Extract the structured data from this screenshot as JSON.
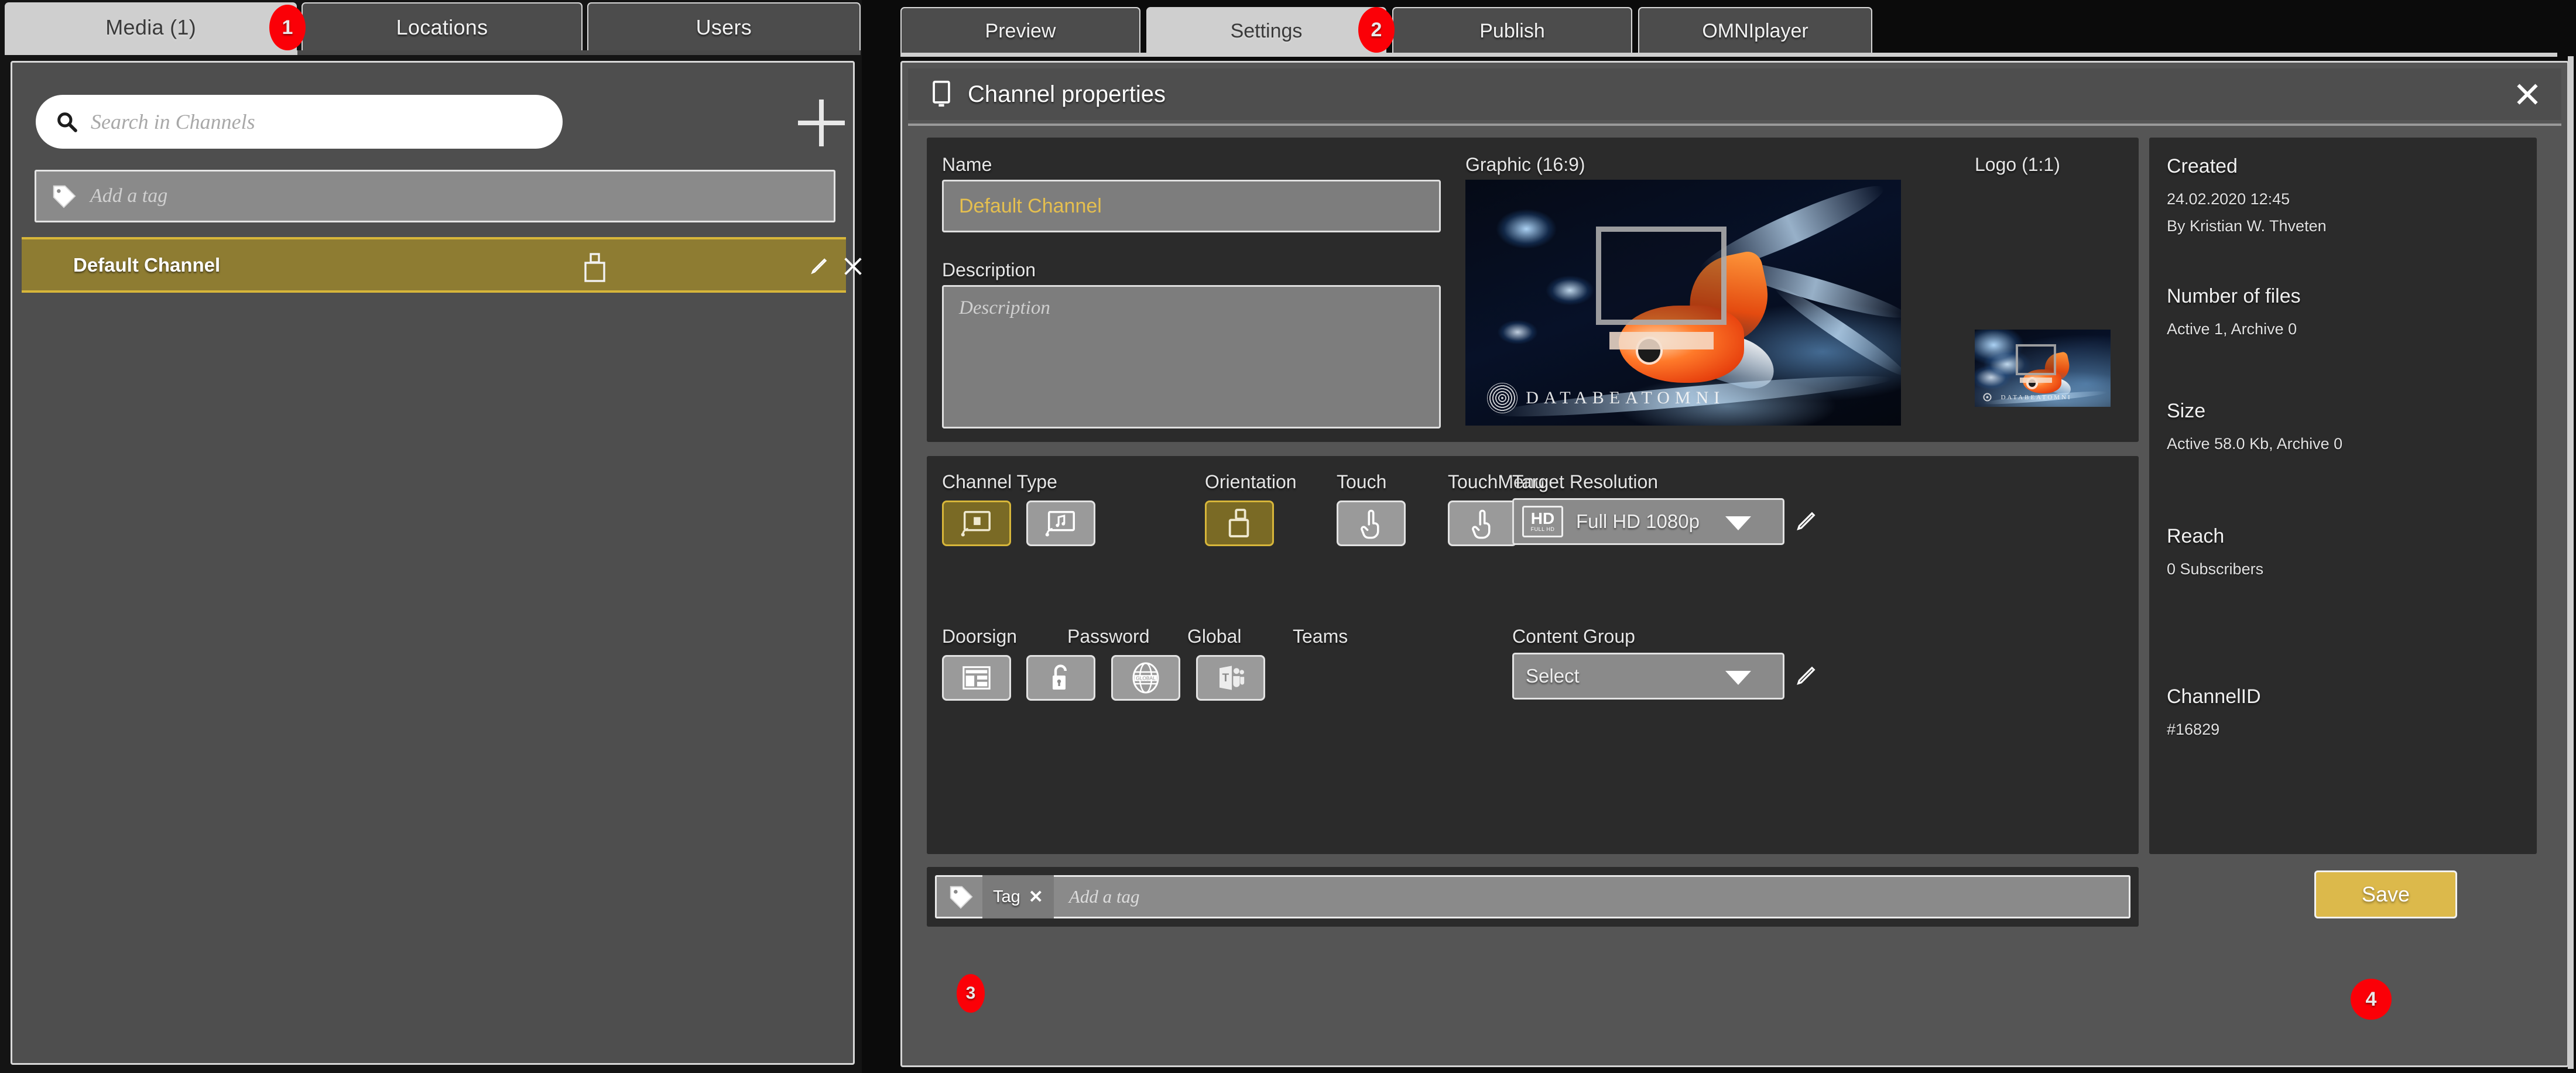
{
  "left": {
    "tabs": [
      {
        "label": "Media (1)",
        "active": true
      },
      {
        "label": "Locations",
        "active": false
      },
      {
        "label": "Users",
        "active": false
      }
    ],
    "search": {
      "placeholder": "Search in Channels",
      "value": "",
      "icon": "search-icon"
    },
    "add_button_icon": "plus-icon",
    "tag_filter": {
      "placeholder": "Add a tag",
      "value": "",
      "icon": "tag-icon"
    },
    "channels": [
      {
        "name": "Default Channel",
        "orientation_icon": "portrait-icon",
        "edit_icon": "pencil-icon",
        "close_icon": "close-icon",
        "selected": true
      }
    ]
  },
  "right": {
    "tabs": [
      {
        "label": "Preview",
        "active": false
      },
      {
        "label": "Settings",
        "active": true
      },
      {
        "label": "Publish",
        "active": false
      },
      {
        "label": "OMNIplayer",
        "active": false
      }
    ],
    "dialog": {
      "title": "Channel properties",
      "title_icon": "monitor-icon",
      "close_icon": "close-icon",
      "name": {
        "label": "Name",
        "value": "Default Channel"
      },
      "description": {
        "label": "Description",
        "value": "",
        "placeholder": "Description"
      },
      "graphic": {
        "label": "Graphic (16:9)",
        "watermark": "DATABEATOMNI"
      },
      "logo": {
        "label": "Logo (1:1)",
        "watermark": "DATABEATOMNI"
      },
      "channel_type": {
        "label": "Channel Type",
        "options": [
          {
            "icon": "screen-signage-icon",
            "selected": true
          },
          {
            "icon": "screen-audio-icon",
            "selected": false
          }
        ]
      },
      "orientation": {
        "label": "Orientation",
        "icon": "orientation-portrait-icon",
        "selected": true
      },
      "touch": {
        "label": "Touch",
        "icon": "touch-hand-icon",
        "selected": false
      },
      "touch_menu": {
        "label": "TouchMenu",
        "icon": "touch-hand-icon",
        "selected": false
      },
      "target_resolution": {
        "label": "Target Resolution",
        "value": "Full HD 1080p",
        "badge": "HD",
        "badge_sub": "FULL HD",
        "caret_icon": "chevron-down-icon",
        "edit_icon": "pencil-icon"
      },
      "doorsign": {
        "label": "Doorsign",
        "icon": "doorsign-icon",
        "selected": false
      },
      "password": {
        "label": "Password",
        "icon": "unlock-icon",
        "selected": false
      },
      "global": {
        "label": "Global",
        "icon": "globe-icon",
        "icon_text": "GLOBAL",
        "selected": false
      },
      "teams": {
        "label": "Teams",
        "icon": "teams-icon",
        "selected": false
      },
      "content_group": {
        "label": "Content Group",
        "value": "Select",
        "caret_icon": "chevron-down-icon",
        "edit_icon": "pencil-icon"
      },
      "tag_row": {
        "icon": "tag-icon",
        "chips": [
          {
            "label": "Tag",
            "remove_icon": "close-icon"
          }
        ],
        "placeholder": "Add a tag"
      },
      "save_label": "Save"
    },
    "info": {
      "created": {
        "label": "Created",
        "date": "24.02.2020 12:45",
        "by": "By Kristian W. Thveten"
      },
      "number_of_files": {
        "label": "Number of files",
        "value": "Active 1, Archive 0"
      },
      "size": {
        "label": "Size",
        "value": "Active 58.0 Kb, Archive 0"
      },
      "reach": {
        "label": "Reach",
        "value": "0 Subscribers"
      },
      "channel_id": {
        "label": "ChannelID",
        "value": "#16829"
      }
    }
  },
  "badges": {
    "one": "1",
    "two": "2",
    "three": "3",
    "four": "4"
  },
  "colors": {
    "accent_gold": "#d7b63a",
    "selected_fill": "#7a6a25",
    "save_button": "#dcb94b",
    "badge_red": "#fb0007",
    "panel_bg": "#555555",
    "card_bg": "#2b2b2b",
    "name_value": "#e5bf4f"
  }
}
